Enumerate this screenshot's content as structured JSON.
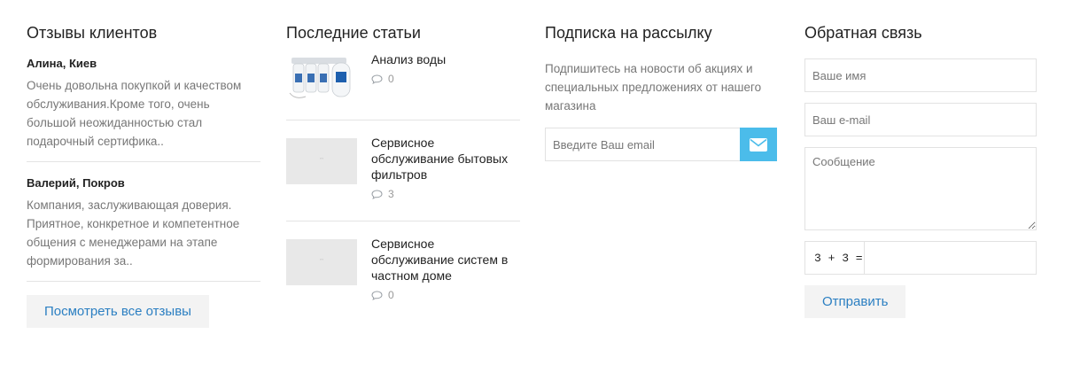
{
  "reviews": {
    "title": "Отзывы клиентов",
    "items": [
      {
        "author": "Алина, Киев",
        "text": "Очень довольна покупкой и качеством обслуживания.Кроме того, очень большой неожиданностью стал подарочный сертификa.."
      },
      {
        "author": "Валерий, Покров",
        "text": "Компания, заслуживающая доверия. Приятное, конкретное и компетентное общения с менеджерами на этапе формирования за.."
      }
    ],
    "all_button": "Посмотреть все отзывы"
  },
  "articles": {
    "title": "Последние статьи",
    "items": [
      {
        "title": "Анализ воды",
        "comments": "0",
        "thumb": "water-filter-photo"
      },
      {
        "title": "Сервисное обслуживание бытовых фильтров",
        "comments": "3",
        "thumb": "placeholder"
      },
      {
        "title": "Сервисное обслуживание систем в частном доме",
        "comments": "0",
        "thumb": "placeholder"
      }
    ]
  },
  "subscribe": {
    "title": "Подписка на рассылку",
    "text": "Подпишитесь на новости об акциях и специальных предложениях от нашего магазина",
    "email_placeholder": "Введите Ваш email",
    "button_icon": "envelope-icon",
    "button_color": "#4bbcea"
  },
  "feedback": {
    "title": "Обратная связь",
    "name_placeholder": "Ваше имя",
    "email_placeholder": "Ваш e-mail",
    "message_placeholder": "Сообщение",
    "captcha_question": "3 + 3 =",
    "submit": "Отправить"
  },
  "colors": {
    "link": "#2b7fc2",
    "accent": "#4bbcea",
    "muted_text": "#777777"
  }
}
